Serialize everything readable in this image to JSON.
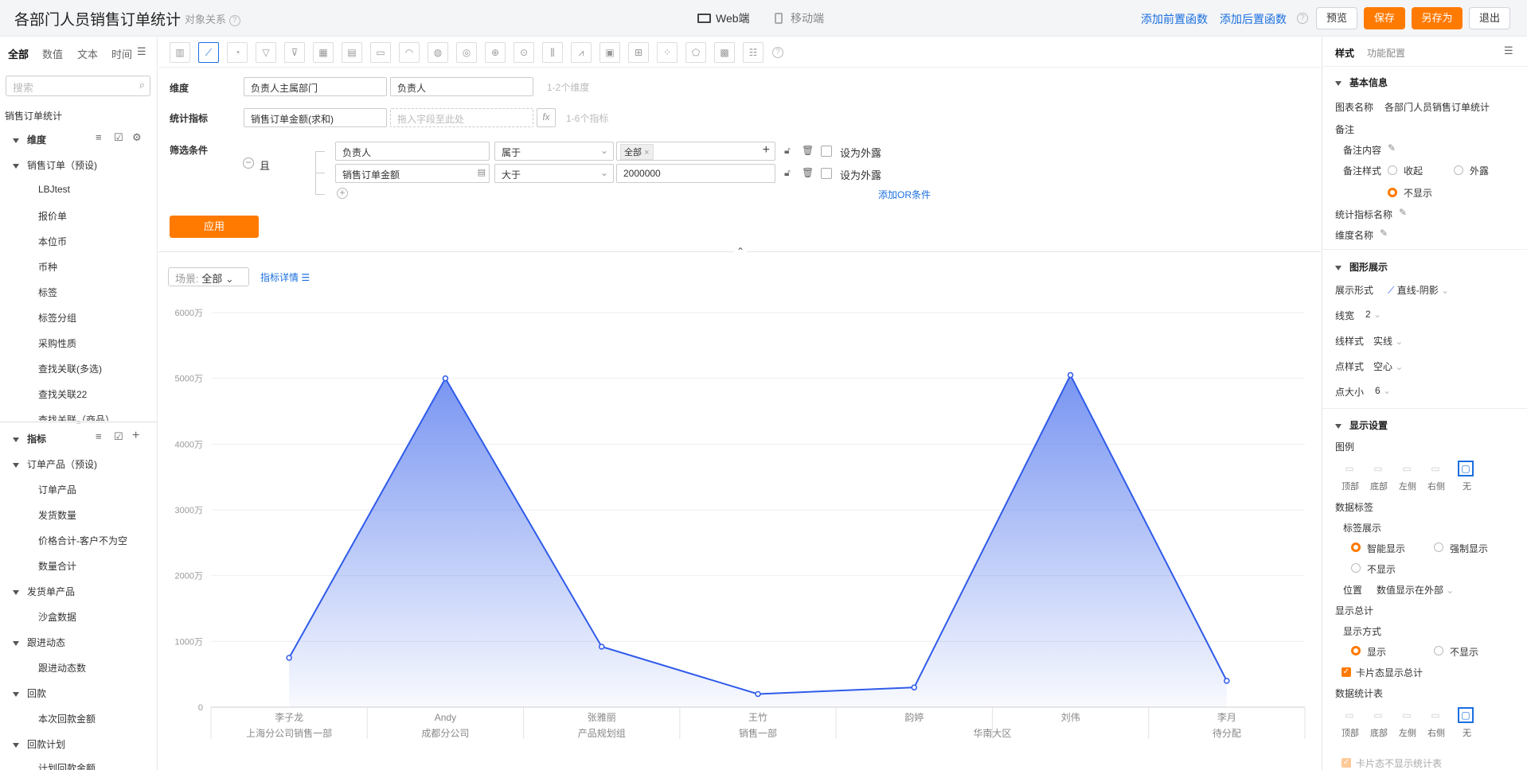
{
  "header": {
    "title": "各部门人员销售订单统计",
    "subtitle": "对象关系",
    "web_label": "Web端",
    "mobile_label": "移动端",
    "pre_func": "添加前置函数",
    "post_func": "添加后置函数",
    "preview": "预览",
    "save": "保存",
    "save_as": "另存为",
    "exit": "退出"
  },
  "left": {
    "tabs": [
      "全部",
      "数值",
      "文本",
      "时间"
    ],
    "search_placeholder": "搜索",
    "root": "销售订单统计",
    "dimension_header": "维度",
    "dimension_group": "销售订单（预设)",
    "dimension_items": [
      "LBJtest",
      "报价单",
      "本位币",
      "币种",
      "标签",
      "标签分组",
      "采购性质",
      "查找关联(多选)",
      "查找关联22",
      "查找关联（商品）"
    ],
    "metric_header": "指标",
    "metric_groups": [
      {
        "label": "订单产品（预设)",
        "items": [
          "订单产品",
          "发货数量",
          "价格合计-客户不为空",
          "数量合计"
        ]
      },
      {
        "label": "发货单产品",
        "items": [
          "沙盒数据"
        ]
      },
      {
        "label": "跟进动态",
        "items": [
          "跟进动态数"
        ]
      },
      {
        "label": "回款",
        "items": [
          "本次回款金额"
        ]
      },
      {
        "label": "回款计划",
        "items": [
          "计划回款金额"
        ]
      }
    ]
  },
  "config": {
    "dimension_label": "维度",
    "dimension_fields": [
      "负责人主属部门",
      "负责人"
    ],
    "dimension_hint": "1-2个维度",
    "metric_label": "统计指标",
    "metric_field": "销售订单金额(求和)",
    "metric_drop": "拖入字段至此处",
    "metric_fx": "fx",
    "metric_hint": "1-6个指标",
    "filter_label": "筛选条件",
    "logic": "且",
    "filters": [
      {
        "field": "负责人",
        "op": "属于",
        "value": "全部",
        "expose": "设为外露"
      },
      {
        "field": "销售订单金额",
        "op": "大于",
        "value": "2000000",
        "expose": "设为外露"
      }
    ],
    "add_or": "添加OR条件",
    "apply": "应用"
  },
  "chart_header": {
    "scene_label": "场景:",
    "scene_value": "全部",
    "detail": "指标详情"
  },
  "chart_data": {
    "type": "area",
    "categories": [
      "李子龙",
      "Andy",
      "张雅丽",
      "王竹",
      "韵婷",
      "刘伟",
      "李月"
    ],
    "groups": [
      {
        "label": "上海分公司销售一部",
        "span": 1
      },
      {
        "label": "成都分公司",
        "span": 1
      },
      {
        "label": "产品规划组",
        "span": 1
      },
      {
        "label": "销售一部",
        "span": 1
      },
      {
        "label": "华南大区",
        "span": 2
      },
      {
        "label": "待分配",
        "span": 1
      }
    ],
    "series": [
      {
        "values": [
          750,
          5000,
          920,
          200,
          300,
          5050,
          400
        ]
      }
    ],
    "ylim": [
      0,
      6000
    ],
    "yticks": [
      "0",
      "1000万",
      "2000万",
      "3000万",
      "4000万",
      "5000万",
      "6000万"
    ],
    "color": "#2f5bea"
  },
  "right": {
    "tabs": [
      "样式",
      "功能配置"
    ],
    "basic_info": "基本信息",
    "chart_name_label": "图表名称",
    "chart_name_value": "各部门人员销售订单统计",
    "note_label": "备注",
    "note_content": "备注内容",
    "note_style": "备注样式",
    "note_options": [
      "收起",
      "外露",
      "不显示"
    ],
    "metric_name": "统计指标名称",
    "dim_name": "维度名称",
    "graph_section": "图形展示",
    "display_form_label": "展示形式",
    "display_form_value": "直线-阴影",
    "line_width_label": "线宽",
    "line_width_value": "2",
    "line_style_label": "线样式",
    "line_style_value": "实线",
    "point_style_label": "点样式",
    "point_style_value": "空心",
    "point_size_label": "点大小",
    "point_size_value": "6",
    "display_section": "显示设置",
    "legend_label": "图例",
    "legend_options": [
      "顶部",
      "底部",
      "左侧",
      "右侧",
      "无"
    ],
    "data_label": "数据标签",
    "label_show": "标签展示",
    "label_options": [
      "智能显示",
      "强制显示",
      "不显示"
    ],
    "position_label": "位置",
    "position_value": "数值显示在外部",
    "total_label": "显示总计",
    "total_mode": "显示方式",
    "total_options": [
      "显示",
      "不显示"
    ],
    "card_total": "卡片态显示总计",
    "stat_table": "数据统计表",
    "stat_options": [
      "顶部",
      "底部",
      "左侧",
      "右侧",
      "无"
    ],
    "card_hide": "卡片态不显示统计表"
  }
}
